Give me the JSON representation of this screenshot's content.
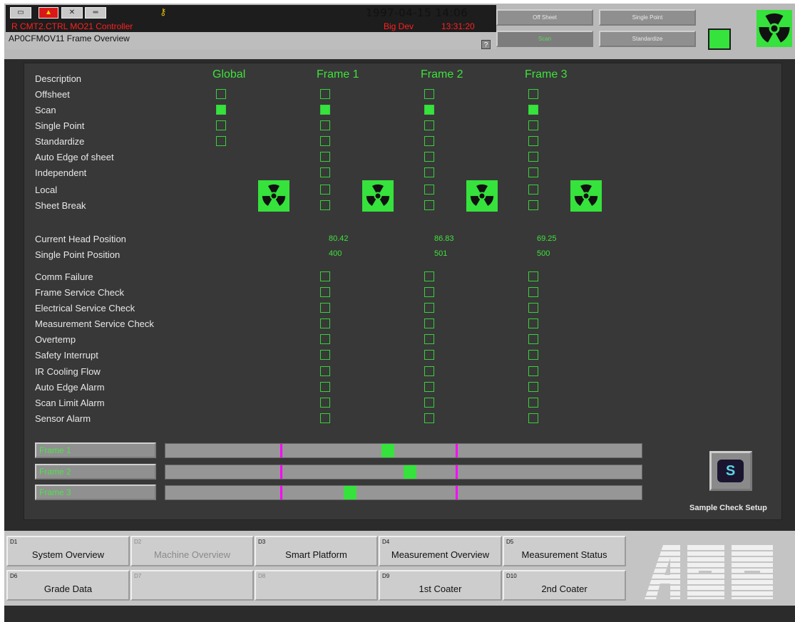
{
  "header": {
    "datetime": "1997-04-15 14:06",
    "path": "R  CMT2.CTRL  MO21 Controller",
    "device": "Big Dev",
    "time2": "13:31:20",
    "display_name": "AP0CFMOV11  Frame Overview",
    "help": "?",
    "buttons": {
      "off_sheet": "Off Sheet",
      "single_point": "Single Point",
      "scan": "Scan",
      "standardize": "Standardize"
    }
  },
  "columns": {
    "global": "Global",
    "frame1": "Frame 1",
    "frame2": "Frame 2",
    "frame3": "Frame 3"
  },
  "status_rows": {
    "description": "Description",
    "offsheet": "Offsheet",
    "scan": "Scan",
    "single_point": "Single Point",
    "standardize": "Standardize",
    "auto_edge": "Auto Edge of sheet",
    "independent": "Independent",
    "local": "Local",
    "sheet_break": "Sheet Break"
  },
  "positions": {
    "current_head_label": "Current Head Position",
    "single_point_label": "Single Point Position",
    "current_head": [
      "80.42",
      "86.83",
      "69.25"
    ],
    "single_point": [
      "400",
      "501",
      "500"
    ]
  },
  "alarms": {
    "comm_failure": "Comm Failure",
    "frame_service": "Frame Service Check",
    "electrical_service": "Electrical Service Check",
    "measurement_service": "Measurement Service Check",
    "overtemp": "Overtemp",
    "safety_interrupt": "Safety Interrupt",
    "ir_cooling": "IR Cooling Flow",
    "auto_edge_alarm": "Auto Edge Alarm",
    "scan_limit": "Scan Limit Alarm",
    "sensor_alarm": "Sensor Alarm"
  },
  "frames": {
    "frame1": "Frame 1",
    "frame2": "Frame 2",
    "frame3": "Frame 3"
  },
  "sample_check": {
    "icon_letter": "S",
    "label": "Sample Check Setup"
  },
  "nav": {
    "d1": {
      "key": "D1",
      "label": "System Overview"
    },
    "d2": {
      "key": "D2",
      "label": "Machine Overview"
    },
    "d3": {
      "key": "D3",
      "label": "Smart Platform"
    },
    "d4": {
      "key": "D4",
      "label": "Measurement Overview"
    },
    "d5": {
      "key": "D5",
      "label": "Measurement Status"
    },
    "d6": {
      "key": "D6",
      "label": "Grade Data"
    },
    "d7": {
      "key": "D7",
      "label": ""
    },
    "d8": {
      "key": "D8",
      "label": ""
    },
    "d9": {
      "key": "D9",
      "label": "1st Coater"
    },
    "d10": {
      "key": "D10",
      "label": "2nd Coater"
    }
  },
  "logo": "ABB",
  "colors": {
    "active_green": "#36e23c",
    "marker_magenta": "#ff00ff",
    "alarm_red": "#ff2020"
  }
}
